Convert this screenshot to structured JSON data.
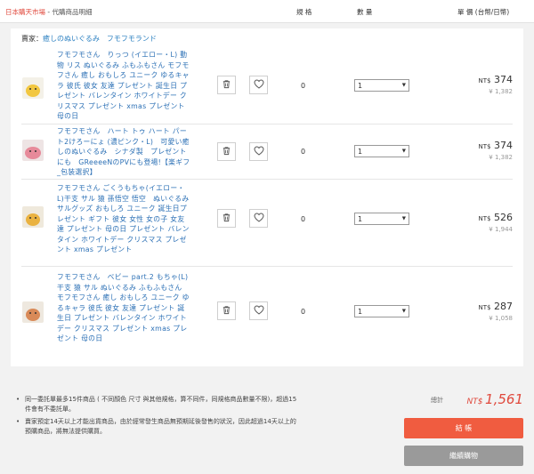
{
  "header": {
    "store_name": "日本購天市場",
    "store_sep": " - ",
    "store_desc": "代購商品明細",
    "col_spec": "規 格",
    "col_qty": "數 量",
    "col_price": "單 價 (台幣/日幣)"
  },
  "seller": {
    "label": "賣家：",
    "name": "癒しのぬいぐるみ　フモフモランド"
  },
  "items": [
    {
      "title": "フモフモさん　りっつ (イエロー・L) 動物 リス ぬいぐるみ ふもふもさん モフモフさん 癒し おもしろ ユニーク ゆるキャラ 彼氏 彼女 友達 プレゼント 誕生日 プレゼント バレンタイン ホワイトデー クリスマス プレゼント xmas プレゼント 母の日",
      "spec": "0",
      "qty": "1",
      "price_twd": "374",
      "price_jpy": "¥ 1,382"
    },
    {
      "title": "フモフモさん　ハート トゥ ハート パート2けろーにょ (濃ピンク・L)　可愛い癒しのぬいぐるみ　シナダ製　プレゼントにも　GReeeeNのPVにも登場!【楽ギフ_包装選択】",
      "spec": "0",
      "qty": "1",
      "price_twd": "374",
      "price_jpy": "¥ 1,382"
    },
    {
      "title": "フモフモさん ごくうもちゃ(イエロー・L)干支 サル 猿 孫悟空 悟空　ぬいぐるみ サルグッズ おもしろ ユニーク 誕生日プレゼント ギフト 彼女 女性 女の子 女友達 プレゼント 母の日 プレゼント バレンタイン ホワイトデー クリスマス プレゼント xmas プレゼント",
      "spec": "0",
      "qty": "1",
      "price_twd": "526",
      "price_jpy": "¥ 1,944"
    },
    {
      "title": "フモフモさん　ベビー part.2 もちゃ(L) 干支 猿 サル ぬいぐるみ ふもふもさん モフモフさん 癒し おもしろ ユニーク ゆるキャラ 彼氏 彼女 友達 プレゼント 誕生日 プレゼント バレンタイン ホワイトデー クリスマス プレゼント xmas プレゼント 母の日",
      "spec": "0",
      "qty": "1",
      "price_twd": "287",
      "price_jpy": "¥ 1,058"
    }
  ],
  "currency_prefix": "NT$",
  "notes": [
    "同一委託單最多15件商品 ( 不同顏色 尺寸 與其他規格，算不同件，同規格商品數量不限)，超過15件會有不委託單。",
    "賣家預定14天以上才能出貨商品，由於經常發生商品無預期延後發售的狀況，因此超過14天以上的預購商品，將無法提供購買。"
  ],
  "summary": {
    "total_label": "總計",
    "total_currency": "NT$",
    "total_value": "1,561"
  },
  "buttons": {
    "checkout": "結 帳",
    "continue": "繼續購物"
  },
  "icons": {
    "delete": "trash-icon",
    "favorite": "heart-icon",
    "dropdown": "caret-down-icon"
  }
}
